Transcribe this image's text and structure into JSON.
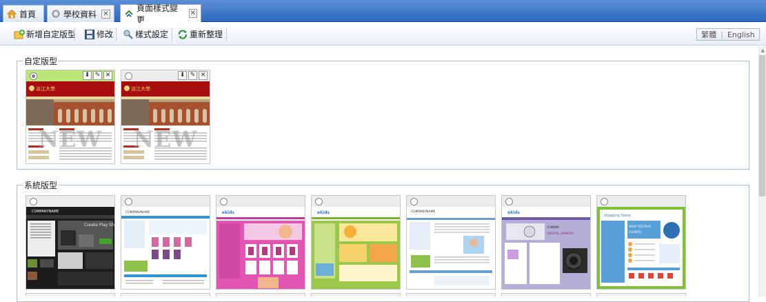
{
  "tabs": [
    {
      "label": "首頁",
      "icon": "home-icon"
    },
    {
      "label": "學校資料",
      "icon": "gear-icon"
    },
    {
      "label": "頁面樣式變更",
      "icon": "layout-icon"
    }
  ],
  "toolbar": {
    "buttons": [
      {
        "label": "新增自定版型",
        "icon": "add-layout-icon"
      },
      {
        "label": "修改",
        "icon": "save-icon"
      },
      {
        "label": "樣式設定",
        "icon": "style-settings-icon"
      },
      {
        "label": "重新整理",
        "icon": "refresh-icon"
      }
    ],
    "lang_traditional": "繁體",
    "lang_english": "English"
  },
  "custom_section": {
    "title": "自定版型",
    "badge_text": "NEW",
    "cards": [
      {
        "selected": true
      },
      {
        "selected": false
      }
    ]
  },
  "system_section": {
    "title": "系統版型",
    "thumbnail_texts": {
      "company_name": "COMPANYNAME",
      "tagline": "Create Play Share",
      "digital_camera": "DIGITAL CAMERA",
      "what_you_play": "WHAT YOU PLAY COUNTS!"
    }
  },
  "colors": {
    "tab_bar": "#2e69c0",
    "fieldset_border": "#a3bde0",
    "card_highlight": "#bde67a",
    "banner_red": "#a80d0d"
  }
}
